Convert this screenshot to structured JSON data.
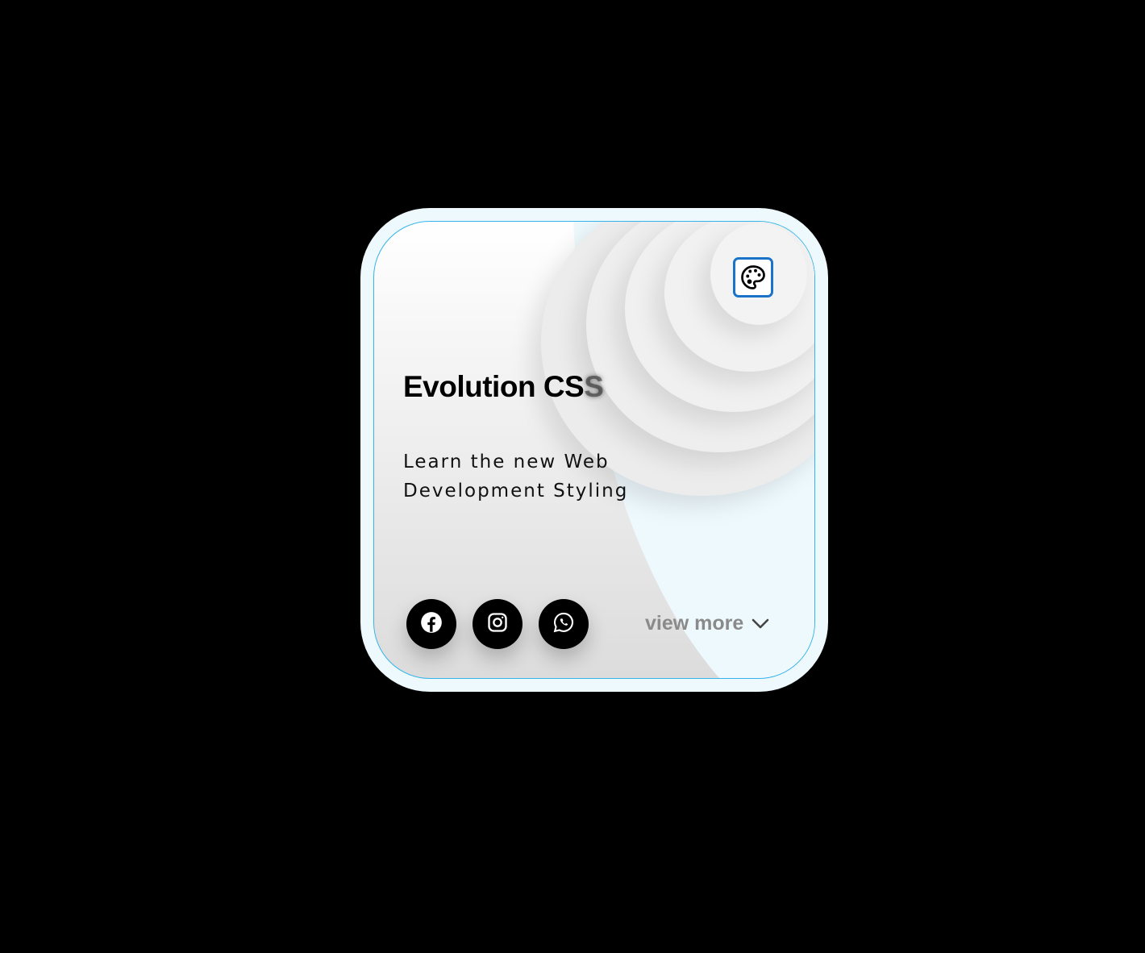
{
  "card": {
    "title_main": "Evolution CS",
    "title_fade": "S",
    "description": "Learn the new Web Development Styling",
    "view_more": "view more",
    "palette_icon": "palette-icon",
    "social": [
      {
        "icon": "facebook-icon"
      },
      {
        "icon": "instagram-icon"
      },
      {
        "icon": "whatsapp-icon"
      }
    ]
  },
  "colors": {
    "page_background": "#000000",
    "card_outer": "#eef9fd",
    "card_border": "#34b4ea",
    "palette_border": "#1b73c9",
    "social_button": "#000000",
    "view_more_text": "#8a8a8a"
  }
}
